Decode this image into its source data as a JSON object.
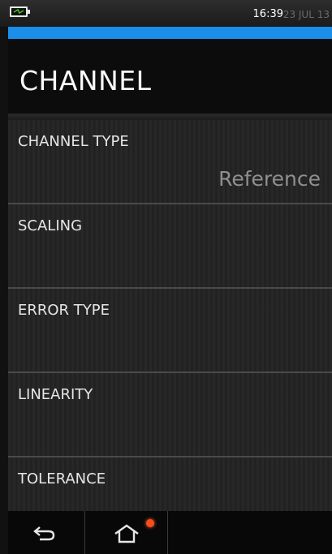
{
  "status": {
    "time": "16:39",
    "date": "23 JUL 13",
    "battery_icon": "battery-charging-icon"
  },
  "header": {
    "title": "CHANNEL"
  },
  "items": [
    {
      "label": "CHANNEL TYPE",
      "value": "Reference"
    },
    {
      "label": "SCALING",
      "value": ""
    },
    {
      "label": "ERROR TYPE",
      "value": ""
    },
    {
      "label": "LINEARITY",
      "value": ""
    },
    {
      "label": "TOLERANCE",
      "value": ""
    }
  ],
  "nav": {
    "back_icon": "back-arrow-icon",
    "home_icon": "home-icon",
    "notification_color": "#ff4a1c"
  },
  "colors": {
    "accent": "#1a8ee8",
    "background": "#111111"
  }
}
